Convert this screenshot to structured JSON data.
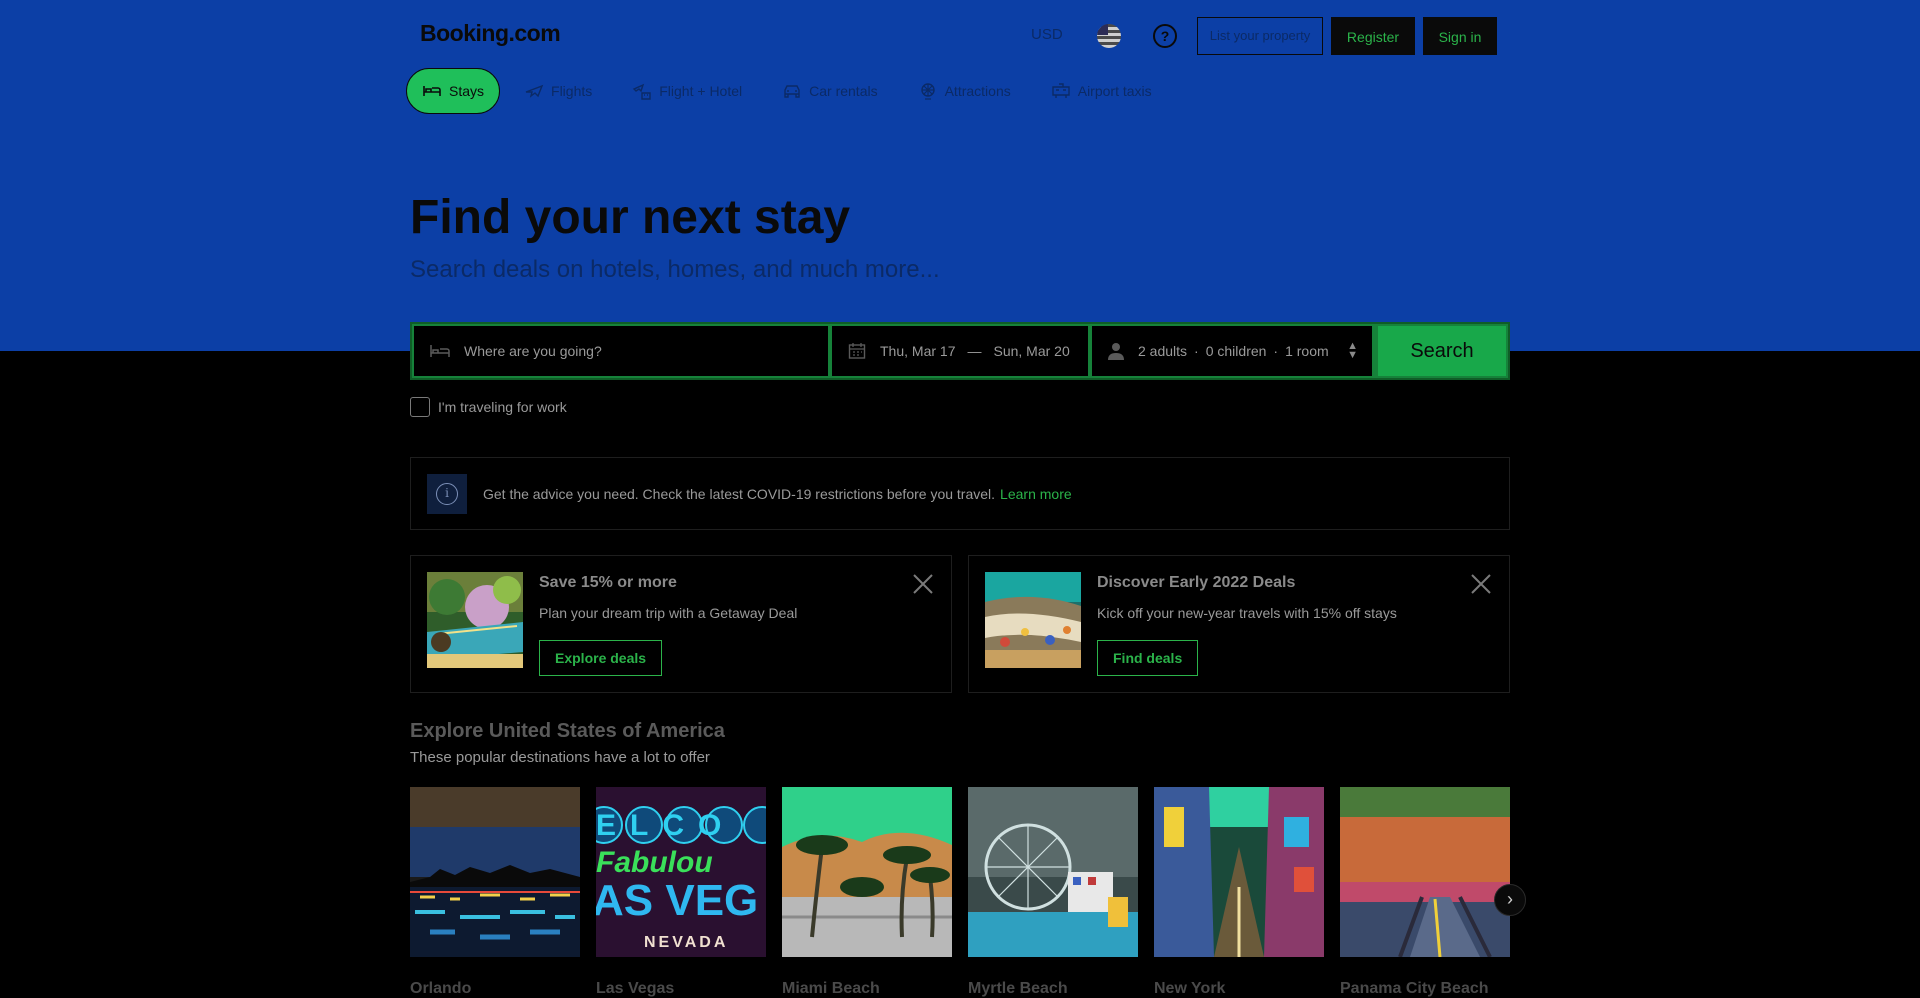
{
  "header": {
    "logo": "Booking.com",
    "currency": "USD",
    "help_icon": "?",
    "list_property": "List your property",
    "register": "Register",
    "sign_in": "Sign in"
  },
  "nav": {
    "items": [
      {
        "label": "Stays",
        "icon": "bed-icon",
        "active": true
      },
      {
        "label": "Flights",
        "icon": "plane-icon"
      },
      {
        "label": "Flight + Hotel",
        "icon": "flight-hotel-icon"
      },
      {
        "label": "Car rentals",
        "icon": "car-icon"
      },
      {
        "label": "Attractions",
        "icon": "attractions-icon"
      },
      {
        "label": "Airport taxis",
        "icon": "taxi-icon"
      }
    ]
  },
  "hero": {
    "title": "Find your next stay",
    "subtitle": "Search deals on hotels, homes, and much more..."
  },
  "search": {
    "destination_placeholder": "Where are you going?",
    "checkin": "Thu, Mar 17",
    "dash": "—",
    "checkout": "Sun, Mar 20",
    "adults": "2 adults",
    "children": "0 children",
    "rooms": "1 room",
    "dot": "·",
    "button": "Search",
    "work_label": "I'm traveling for work"
  },
  "notice": {
    "text": "Get the advice you need. Check the latest COVID-19 restrictions before you travel.",
    "link": "Learn more"
  },
  "promos": [
    {
      "title": "Save 15% or more",
      "subtitle": "Plan your dream trip with a Getaway Deal",
      "button": "Explore deals"
    },
    {
      "title": "Discover Early 2022 Deals",
      "subtitle": "Kick off your new-year travels with 15% off stays",
      "button": "Find deals"
    }
  ],
  "explore": {
    "title": "Explore United States of America",
    "subtitle": "These popular destinations have a lot to offer",
    "destinations": [
      {
        "name": "Orlando"
      },
      {
        "name": "Las Vegas",
        "sign_top": "ELCO",
        "sign_mid": "Fabulou",
        "sign_big": "AS VEG",
        "sign_bottom": "NEVADA"
      },
      {
        "name": "Miami Beach"
      },
      {
        "name": "Myrtle Beach"
      },
      {
        "name": "New York"
      },
      {
        "name": "Panama City Beach"
      }
    ],
    "next_icon": "›"
  },
  "colors": {
    "hero_bg": "#0c3fa6",
    "accent_green": "#2bb34a",
    "page_bg": "#000000"
  }
}
